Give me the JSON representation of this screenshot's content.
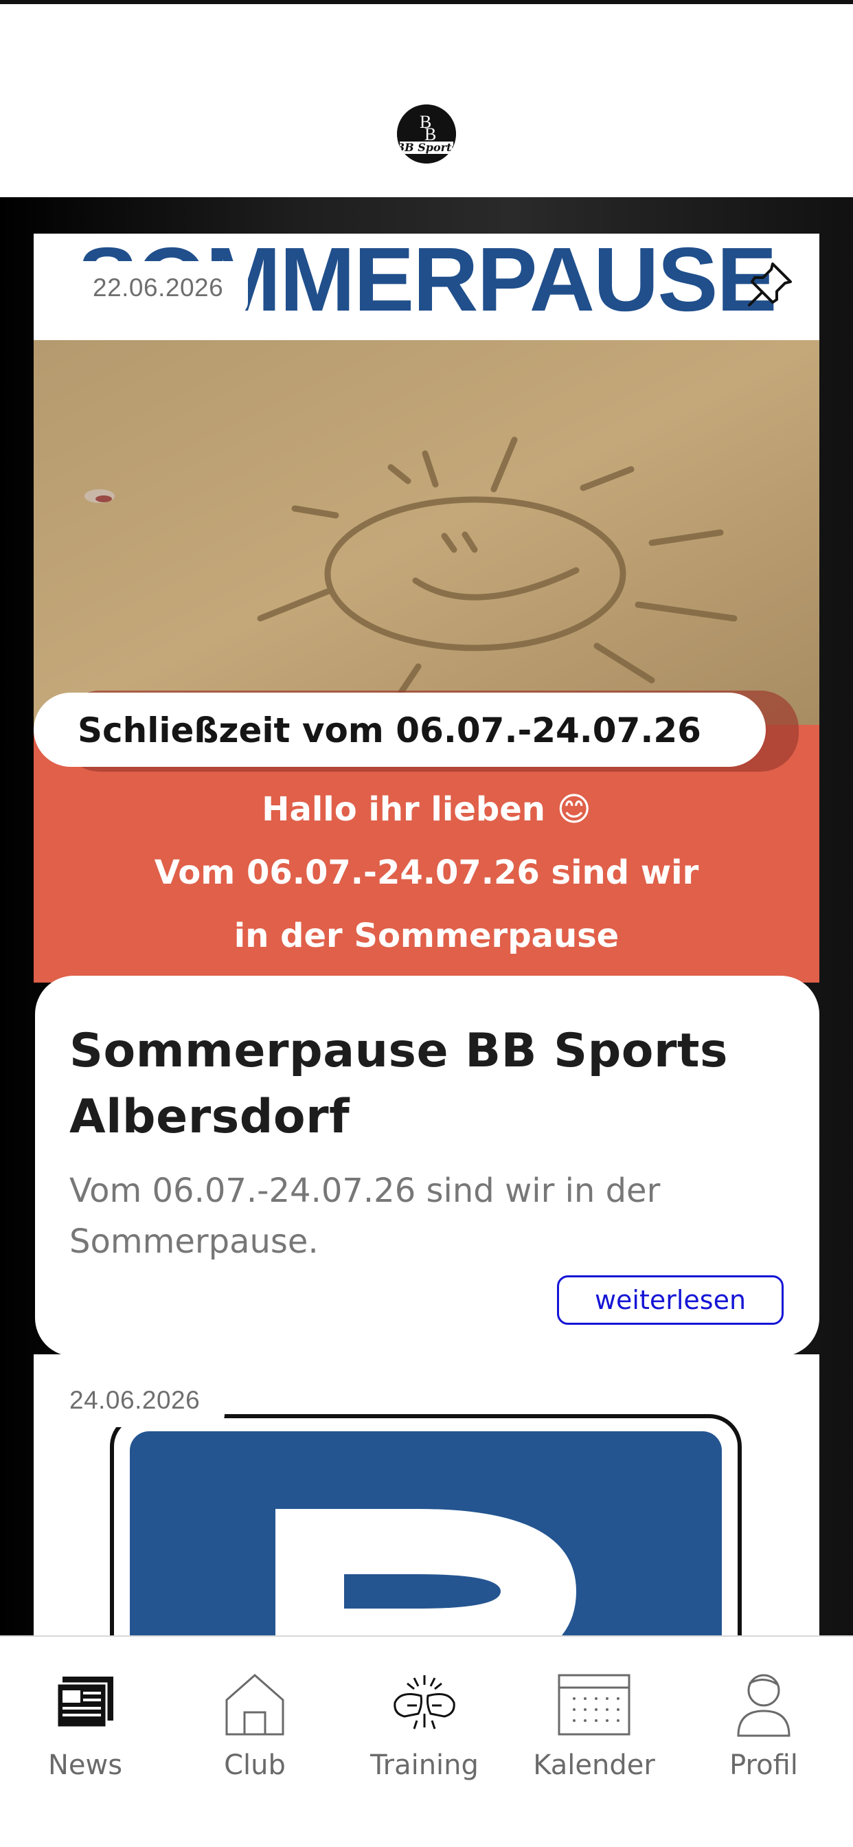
{
  "header": {
    "logo": "BB Sports logo",
    "logo_text": "BB Sports"
  },
  "feed": {
    "posts": [
      {
        "date": "22.06.2026",
        "pinned": true,
        "image": {
          "headline": "SOMMERPAUSE",
          "closing_label": "Schließzeit vom 06.07.-24.07.26",
          "body_line1": "Hallo ihr lieben 😊",
          "body_line2": "Vom 06.07.-24.07.26 sind wir",
          "body_line3": "in der Sommerpause"
        },
        "title": "Sommerpause BB Sports Albersdorf",
        "excerpt": "Vom 06.07.-24.07.26 sind wir in der Sommerpause.",
        "read_more_label": "weiterlesen"
      },
      {
        "date": "24.06.2026",
        "image_icon": "parking-sign-icon"
      }
    ]
  },
  "tabbar": {
    "tabs": [
      {
        "label": "News",
        "icon": "newspaper-icon",
        "active": true
      },
      {
        "label": "Club",
        "icon": "house-icon",
        "active": false
      },
      {
        "label": "Training",
        "icon": "boxing-gloves-icon",
        "active": false
      },
      {
        "label": "Kalender",
        "icon": "calendar-icon",
        "active": false
      },
      {
        "label": "Profil",
        "icon": "person-icon",
        "active": false
      }
    ]
  },
  "colors": {
    "accent_blue": "#1515d6",
    "banner_coral": "#e0604a",
    "headline_blue": "#204f8c",
    "parking_blue": "#245591"
  }
}
